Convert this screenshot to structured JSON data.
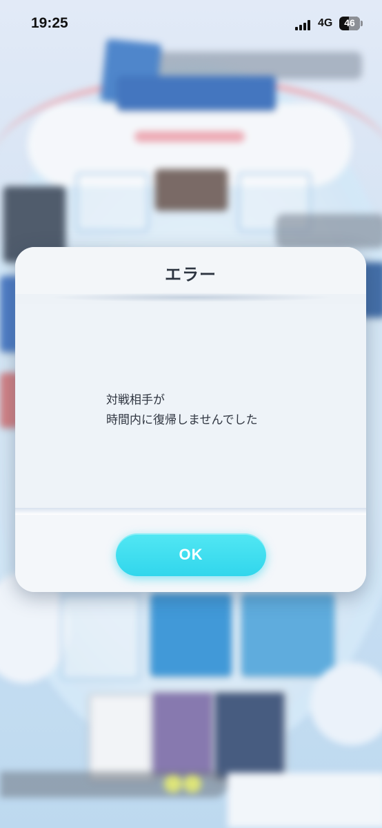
{
  "status_bar": {
    "time": "19:25",
    "network": "4G",
    "battery_level": "46",
    "battery_percent": 46
  },
  "dialog": {
    "title": "エラー",
    "message_lines": [
      "対戦相手が",
      "時間内に復帰しませんでした"
    ],
    "ok_label": "OK",
    "accent_color": "#36d9ee"
  }
}
